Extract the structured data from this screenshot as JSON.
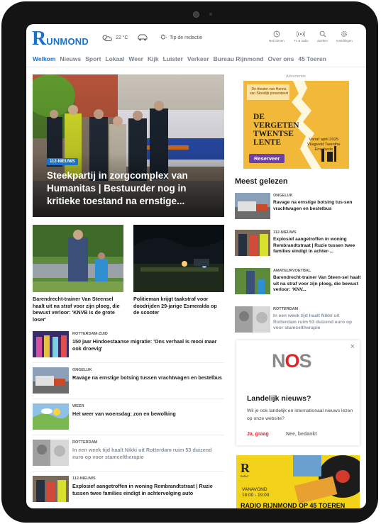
{
  "header": {
    "logo_text": "UNMOND",
    "logo_r": "R",
    "weather": "22 °C",
    "tip": "Tip de redactie",
    "utilities": [
      {
        "label": "Net binnen",
        "icon": "clock-icon"
      },
      {
        "label": "Tv & radio",
        "icon": "broadcast-icon"
      },
      {
        "label": "Zoeken",
        "icon": "search-icon"
      },
      {
        "label": "Instellingen",
        "icon": "gear-icon"
      }
    ]
  },
  "nav": [
    "Welkom",
    "Nieuws",
    "Sport",
    "Lokaal",
    "Weer",
    "Kijk",
    "Luister",
    "Verkeer",
    "Bureau Rijnmond",
    "Over ons",
    "45 Toeren"
  ],
  "hero": {
    "tag": "112-NIEUWS",
    "title": "Steekpartij in zorgcomplex van Humanitas | Bestuurder nog in kritieke toestand na ernstige..."
  },
  "cards": [
    {
      "caption": "Barendrecht-trainer Van Steensel haalt uit na straf voor zijn ploeg, die bewust verloor: 'KNVB is de grote loser'"
    },
    {
      "caption": "Politieman krijgt taakstraf voor doodrijden 29-jarige Esmeralda op de scooter"
    }
  ],
  "list": [
    {
      "category": "ROTTERDAM-ZUID",
      "title": "150 jaar Hindoestaanse migratie: 'Ons verhaal is mooi maar ook droevig'",
      "dim": false
    },
    {
      "category": "ONGELUK",
      "title": "Ravage na ernstige botsing tussen vrachtwagen en bestelbus",
      "dim": false
    },
    {
      "category": "WEER",
      "title": "Het weer van woensdag: zon en bewolking",
      "dim": false
    },
    {
      "category": "ROTTERDAM",
      "title": "In een week tijd haalt Nikki uit Rotterdam ruim 53 duizend euro op voor stamceltherapie",
      "dim": true
    },
    {
      "category": "112-NIEUWS",
      "title": "Explosief aangetroffen in woning Rembrandtstraat | Ruzie tussen twee families eindigt in achtervolging auto",
      "dim": false
    }
  ],
  "ad": {
    "label": "Advertentie",
    "top_text": "De theater van Hanna van Stoodijk presenteert",
    "title_lines": [
      "DE",
      "VERGETEN",
      "TWENTSE",
      "LENTE"
    ],
    "date_text": "Vanaf april 2025\nVlisgveld Twenthe\nEnschede",
    "button": "Reserveer"
  },
  "meest_gelezen": {
    "title": "Meest gelezen",
    "items": [
      {
        "category": "ONGELUK",
        "title": "Ravage na ernstige botsing tus-sen vrachtwagen en bestelbus",
        "dim": false
      },
      {
        "category": "112-NIEUWS",
        "title": "Explosief aangetroffen in woning Rembrandtstraat | Ruzie tussen twee families eindigt in achter-...",
        "dim": false
      },
      {
        "category": "AMATEURVOETBAL",
        "title": "Barendrecht-trainer Van Steen-sel haalt uit na straf voor zijn ploeg, die bewust verloor: 'KNV...",
        "dim": false
      },
      {
        "category": "ROTTERDAM",
        "title": "In een week tijd haalt Nikki uit Rotterdam ruim 53 duizend euro op voor stamceltherapie",
        "dim": true
      }
    ]
  },
  "nos": {
    "logo_n": "N",
    "logo_o": "O",
    "logo_s": "S",
    "heading": "Landelijk nieuws?",
    "body": "Wil je ook landelijk en internationaal nieuws lezen op onze website?",
    "yes": "Ja, graag",
    "no": "Nee, bedankt",
    "close": "×"
  },
  "banner": {
    "logo": "R",
    "logo_sub": "RADIO",
    "line1": "VANAVOND",
    "line2": "18:00 - 19:00",
    "title": "RADIO RIJNMOND OP 45 TOEREN"
  },
  "colors": {
    "accent": "#1a73c8",
    "nos_red": "#e4242b",
    "ad_yellow": "#f2b83a",
    "ad_purple": "#6d3fa7"
  }
}
